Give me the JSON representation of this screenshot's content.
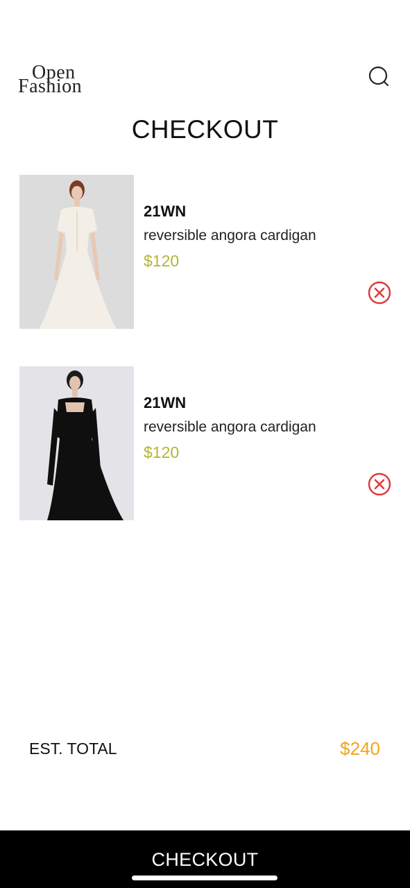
{
  "header": {
    "logo_line1": "Open",
    "logo_line2": "Fashion",
    "search_icon": "search-icon"
  },
  "page": {
    "title": "CHECKOUT"
  },
  "cart": {
    "items": [
      {
        "brand": "21WN",
        "description": "reversible angora cardigan",
        "price": "$120",
        "remove_icon": "close-circle-icon"
      },
      {
        "brand": "21WN",
        "description": "reversible angora cardigan",
        "price": "$120",
        "remove_icon": "close-circle-icon"
      }
    ]
  },
  "summary": {
    "total_label": "EST. TOTAL",
    "total_value": "$240"
  },
  "footer": {
    "checkout_label": "CHECKOUT"
  },
  "colors": {
    "price": "#b4b431",
    "total": "#f2a516",
    "remove": "#e03a3a",
    "bar": "#000000"
  }
}
